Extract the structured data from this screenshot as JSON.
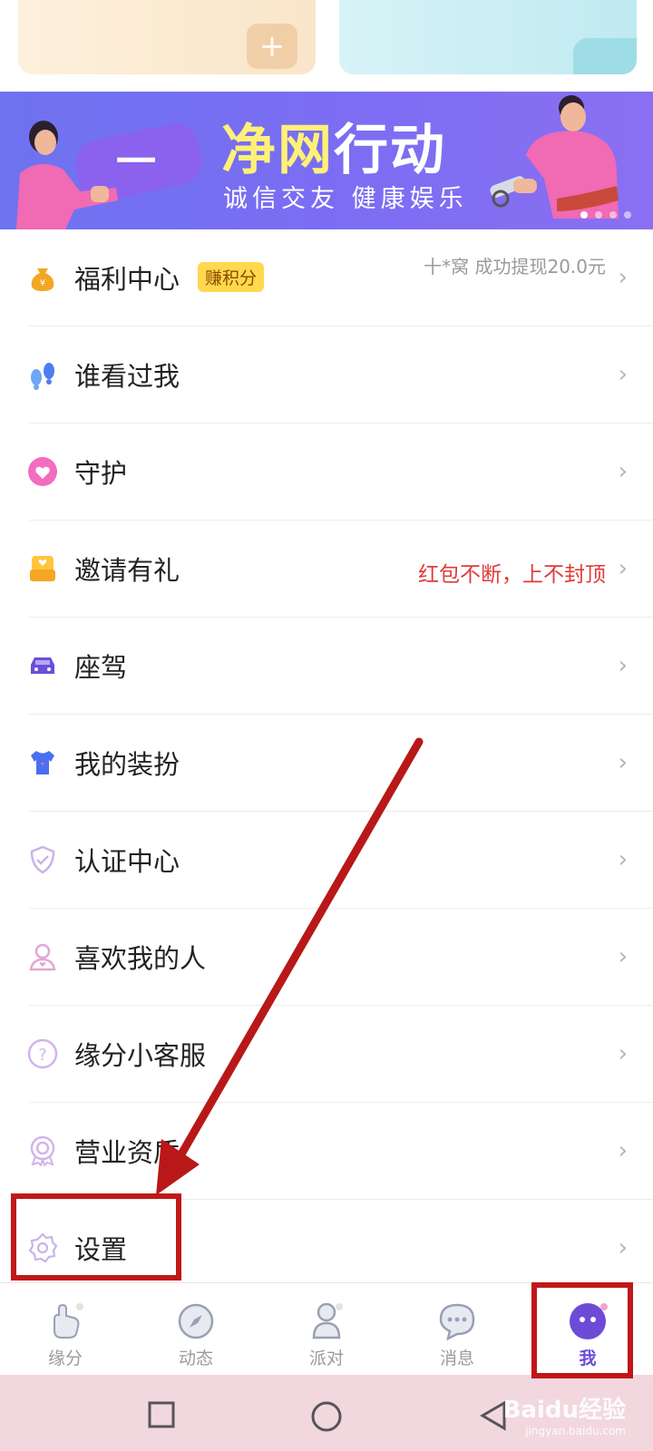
{
  "banner": {
    "title_part1": "净网",
    "title_part2": "行动",
    "subtitle": "诚信交友 健康娱乐",
    "bubble_text": "一"
  },
  "menu": [
    {
      "label": "福利中心",
      "badge": "赚积分",
      "right_text": "十*窝 成功提现20.0元",
      "icon": "money-bag-icon"
    },
    {
      "label": "谁看过我",
      "icon": "footprints-icon"
    },
    {
      "label": "守护",
      "icon": "heart-icon"
    },
    {
      "label": "邀请有礼",
      "right_text": "红包不断，上不封顶",
      "icon": "gift-icon"
    },
    {
      "label": "座驾",
      "icon": "car-icon"
    },
    {
      "label": "我的装扮",
      "icon": "shirt-icon"
    },
    {
      "label": "认证中心",
      "icon": "shield-check-icon"
    },
    {
      "label": "喜欢我的人",
      "icon": "person-heart-icon"
    },
    {
      "label": "缘分小客服",
      "icon": "help-icon"
    },
    {
      "label": "营业资质",
      "icon": "badge-icon"
    },
    {
      "label": "设置",
      "icon": "gear-icon"
    }
  ],
  "tabs": [
    {
      "label": "缘分",
      "icon": "hand-icon"
    },
    {
      "label": "动态",
      "icon": "compass-icon"
    },
    {
      "label": "派对",
      "icon": "people-icon"
    },
    {
      "label": "消息",
      "icon": "chat-icon"
    },
    {
      "label": "我",
      "icon": "me-avatar-icon",
      "active": true
    }
  ],
  "watermark": {
    "brand": "Baidu经验",
    "url": "jingyan.baidu.com"
  },
  "colors": {
    "accent": "#6d4bd6",
    "annotation": "#c01818",
    "promo_red": "#e03a3a"
  }
}
